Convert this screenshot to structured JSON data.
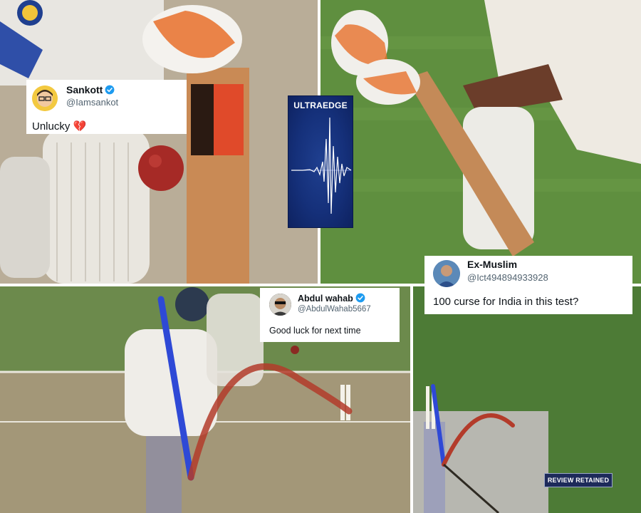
{
  "tweets": [
    {
      "name": "Sankott",
      "verified": true,
      "handle": "@Iamsankot",
      "text": "Unlucky",
      "emoji": "💔"
    },
    {
      "name": "Ex-Muslim",
      "verified": false,
      "handle": "@Ict494894933928",
      "text": "100 curse for India in this test?"
    },
    {
      "name": "Abdul wahab",
      "verified": true,
      "handle": "@AbdulWahab5667",
      "text": "Good luck for next time"
    }
  ],
  "ultraedge": {
    "title": "ULTRAEDGE"
  },
  "review_badge": {
    "text": "REVIEW RETAINED"
  },
  "colors": {
    "verified_blue": "#1d9bf0",
    "ultraedge_bg": "#15307a",
    "tracker_red": "#c0392b",
    "tracker_blue": "#2e49d6"
  }
}
